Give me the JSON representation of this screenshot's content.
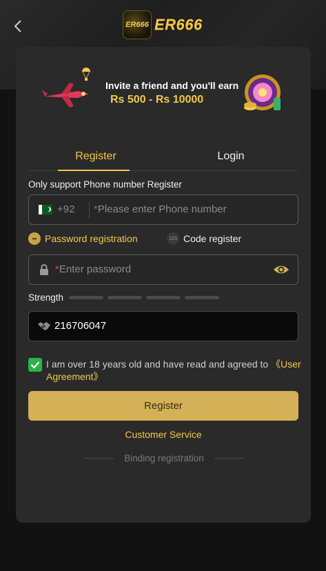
{
  "header": {
    "logo_badge": "ER666",
    "logo_text": "ER666"
  },
  "banner": {
    "line1": "Invite a friend and you'll earn",
    "line2": "Rs 500 - Rs 10000"
  },
  "tabs": [
    {
      "label": "Register",
      "active": true
    },
    {
      "label": "Login",
      "active": false
    }
  ],
  "form": {
    "support_text": "Only support Phone number Register",
    "country_code": "+92",
    "phone_placeholder": "Please enter Phone number",
    "options": {
      "password": "Password registration",
      "code": "Code register",
      "code_icon": "123"
    },
    "password_placeholder": "Enter password",
    "strength_label": "Strength",
    "invite_code": "216706047",
    "agreement_text": "I am over 18 years old and have read and agreed to ",
    "agreement_link": "《User Agreement》",
    "register_button": "Register",
    "customer_service": "Customer Service",
    "binding_registration": "Binding registration"
  },
  "colors": {
    "accent": "#f2c94c",
    "button": "#d4b057",
    "check": "#2bb34a",
    "required": "#e0443e"
  }
}
